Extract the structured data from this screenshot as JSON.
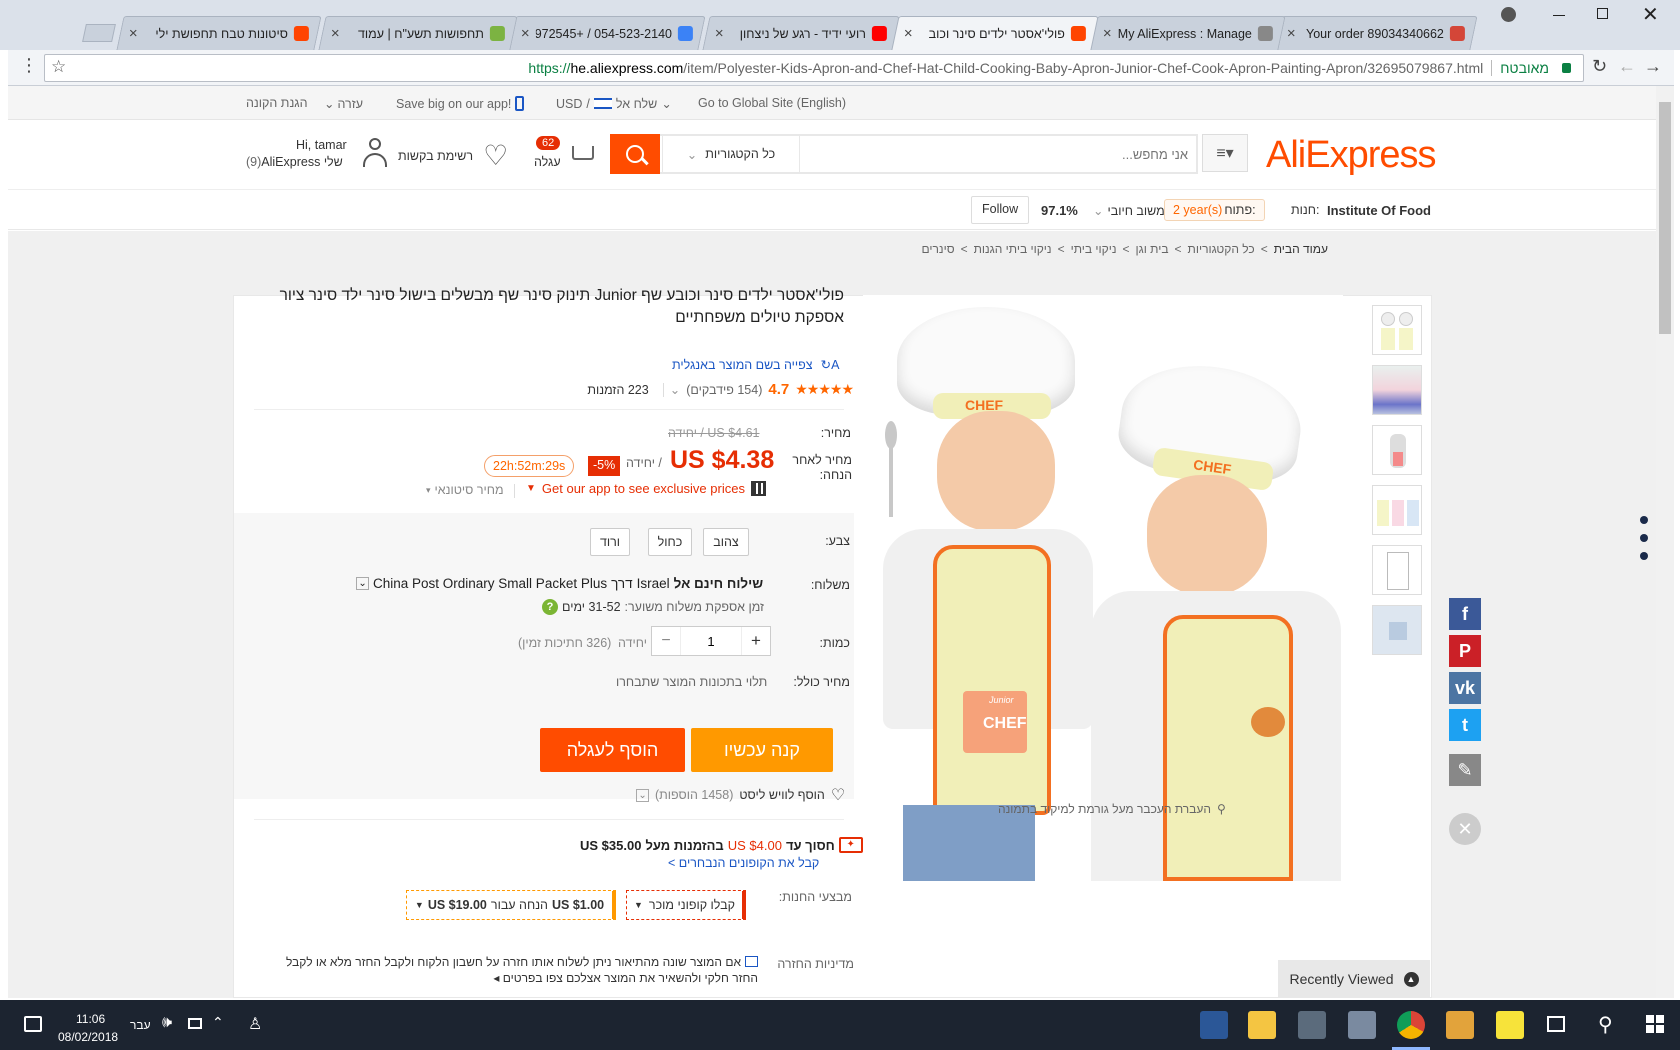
{
  "browser": {
    "tabs": [
      {
        "label": "Your order 89034340662",
        "icon": "gmail-icon",
        "color": "#d44638",
        "active": false
      },
      {
        "label": "My AliExpress : Manage",
        "icon": "document-icon",
        "color": "#888888",
        "active": false
      },
      {
        "label": "פולי'אסטר ילדים סינר וכוב",
        "icon": "aliexpress-icon",
        "color": "#ff4400",
        "active": true
      },
      {
        "label": "רועי ידיד - רגע של ניצחון",
        "icon": "youtube-icon",
        "color": "#ff0000",
        "active": false
      },
      {
        "label": "054-523-2140 / +972545",
        "icon": "phone-icon",
        "color": "#3b82f6",
        "active": false
      },
      {
        "label": "תחפושות תשע\"ח | עמוד",
        "icon": "image-icon",
        "color": "#7cb342",
        "active": false
      },
      {
        "label": "סיטונות טבח תחפושת ילי",
        "icon": "aliexpress-icon",
        "color": "#ff4400",
        "active": false
      }
    ],
    "url_prefix": "https://",
    "url_host": "he.aliexpress.com",
    "url_path": "/item/Polyester-Kids-Apron-and-Chef-Hat-Child-Cooking-Baby-Apron-Junior-Chef-Cook-Apron-Painting-Apron/32695079867.html",
    "secure_label": "מאובטח"
  },
  "topbar": {
    "global_site": "Go to Global Site (English)",
    "ship_to": "שלח אל",
    "currency": "USD",
    "app_promo": "Save big on our app!",
    "help": "עזרה",
    "buyer_protection": "הגנת הקונה"
  },
  "header": {
    "logo": "AliExpress",
    "search_placeholder": "אני מחפש...",
    "category_select": "כל הקטגוריות",
    "cart_count": "62",
    "cart_label": "עגלה",
    "wishlist_label": "רשימת בקשות",
    "greeting": "Hi, tamar",
    "my_account": "AliExpress שלי",
    "my_account_count": "(9)"
  },
  "store": {
    "label": "חנות:",
    "name": "Institute Of Food",
    "open_label": "פתוח:",
    "open_value": "2 year(s)",
    "feedback_label": "משוב חיובי",
    "feedback_value": "97.1%",
    "follow": "Follow"
  },
  "breadcrumb": [
    "עמוד הבית",
    "כל הקטגוריות",
    "בית וגן",
    "ניקוי ביתי",
    "ניקוי ביתי הגנות",
    "סינרים"
  ],
  "product": {
    "title": "פולי'אסטר ילדים סינר וכובע שף Junior תינוק סינר שף מבשלים בישול סינר ילד סינר ציור אספקת טיולים משפחתיים",
    "view_english": "צפייה בשם המוצר באנגלית",
    "rating": "4.7",
    "stars": 5,
    "feedback_count": "(154 פידבקים)",
    "orders": "223 הזמנות",
    "price_label": "מחיר:",
    "old_price": "US $4.61 / יחידה",
    "discount_label": "מחיר לאחר הנחה:",
    "price": "US $4.38",
    "price_unit": "/ יחידה",
    "discount_badge": "-5%",
    "countdown": "22h:52m:29s",
    "app_promo": "Get our app to see exclusive prices",
    "wholesale": "מחיר סיטונאי",
    "color_label": "צבע:",
    "colors": [
      "צהוב",
      "כחול",
      "ורוד"
    ],
    "shipping_label": "משלוח:",
    "shipping_free": "שילוח חינם אל",
    "shipping_country": "Israel",
    "shipping_via": "דרך",
    "shipping_method": "China Post Ordinary Small Packet Plus",
    "delivery_label": "זמן אספקת משלוח משוער:",
    "delivery_value": "31-52 ימים",
    "quantity_label": "כמות:",
    "quantity": "1",
    "quantity_unit": "יחידה",
    "available": "(326 חתיכות זמין)",
    "total_label": "מחיר כולל:",
    "total_value": "תלוי בתכונות המוצר שתבחרו",
    "buy_now": "קנה עכשיו",
    "add_to_cart": "הוסף לעגלה",
    "wishlist": "הוסף לוויש ליסט",
    "wishlist_count": "(1458 הוספות)",
    "coupon_save": "חסוך עד",
    "coupon_amount": "US $4.00",
    "coupon_cond": "בהזמנות מעל",
    "coupon_min": "US $35.00",
    "coupon_link": "קבל את הקופונים הנבחרים >",
    "store_promo_label": "מבצעי החנות:",
    "seller_coupon": "קבלו קופוני מוכר",
    "store_discount_amount": "US $1.00",
    "store_discount_text": "הנחה עבור",
    "store_discount_min": "US $19.00",
    "return_label": "מדיניות החזרה",
    "return_text": "אם המוצר שונה מהתיאור ניתן לשלוח אותו חזרה על חשבון הלקוח ולקבל החזר מלא או לקבל החזר חלקי ולהשאיר את המוצר אצלכם",
    "return_more": "צפו בפרטים",
    "zoom_hint": "העברת העכבר מעל גורמת למיקוד בתמונה",
    "chef_text": "CHEF",
    "junior_text": "Junior"
  },
  "recently_viewed": "Recently Viewed",
  "social": [
    {
      "name": "facebook-icon",
      "glyph": "f",
      "color": "#3b5998"
    },
    {
      "name": "pinterest-icon",
      "glyph": "P",
      "color": "#cb2027"
    },
    {
      "name": "vk-icon",
      "glyph": "vk",
      "color": "#4c75a3"
    },
    {
      "name": "twitter-icon",
      "glyph": "t",
      "color": "#1da1f2"
    },
    {
      "name": "edit-icon",
      "glyph": "✎",
      "color": "#888888"
    }
  ],
  "taskbar": {
    "time": "11:06",
    "date": "08/02/2018",
    "lang": "עבר"
  }
}
